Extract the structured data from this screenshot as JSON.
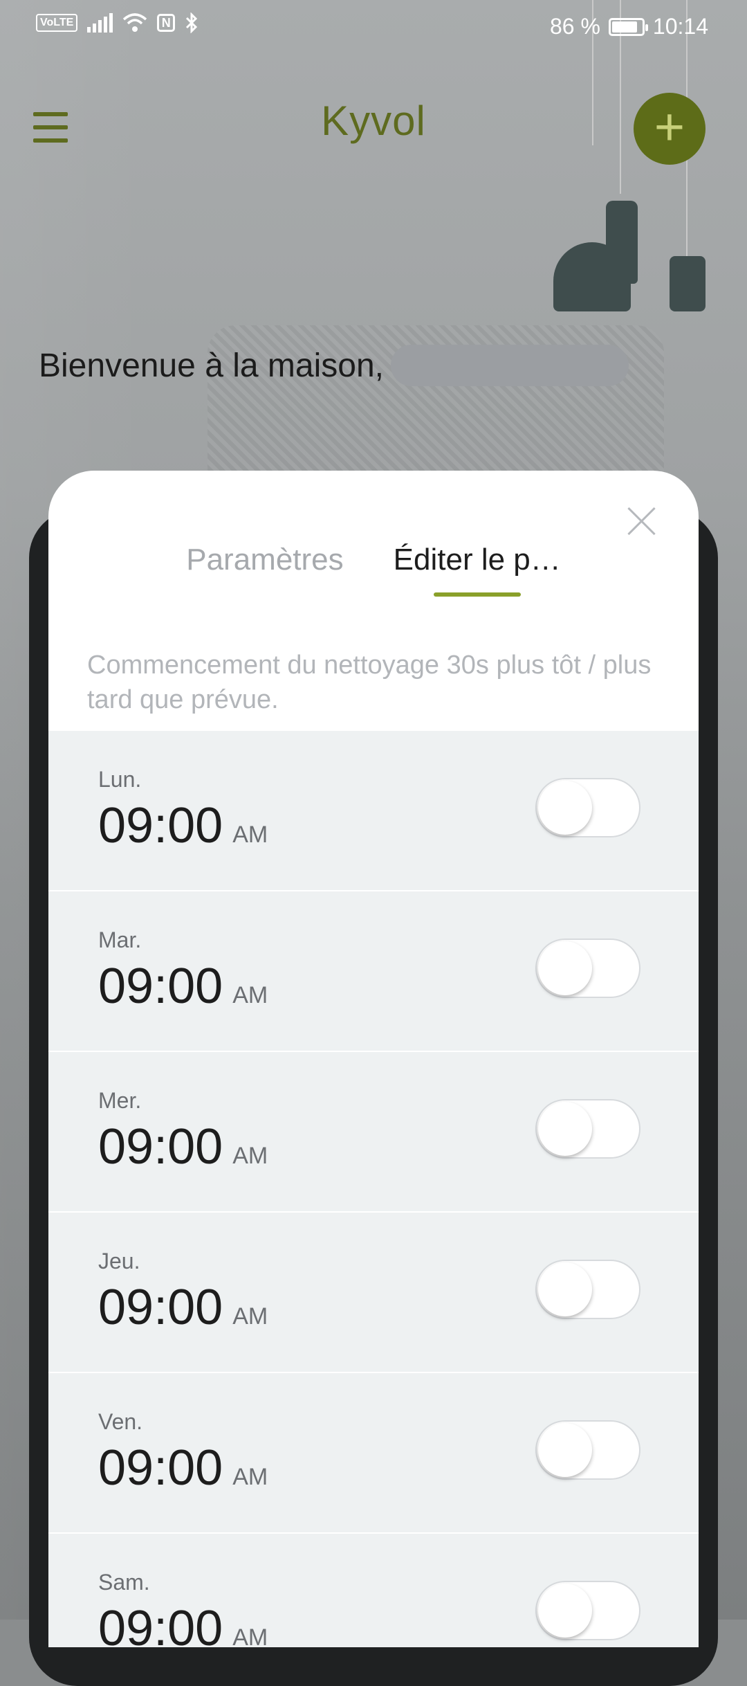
{
  "status_bar": {
    "volte": "VoLTE",
    "nfc": "N",
    "battery_percent": "86 %",
    "battery_level": 0.86,
    "time": "10:14"
  },
  "header": {
    "logo_text": "Kyvol",
    "add_label": "+"
  },
  "welcome": {
    "text": "Bienvenue à la maison,"
  },
  "sheet": {
    "tabs": [
      {
        "label": "Paramètres",
        "active": false
      },
      {
        "label": "Éditer le p…",
        "active": true
      }
    ],
    "hint": "Commencement du nettoyage 30s plus tôt / plus tard que prévue.",
    "schedule": [
      {
        "day": "Lun.",
        "time": "09:00",
        "ampm": "AM",
        "enabled": false
      },
      {
        "day": "Mar.",
        "time": "09:00",
        "ampm": "AM",
        "enabled": false
      },
      {
        "day": "Mer.",
        "time": "09:00",
        "ampm": "AM",
        "enabled": false
      },
      {
        "day": "Jeu.",
        "time": "09:00",
        "ampm": "AM",
        "enabled": false
      },
      {
        "day": "Ven.",
        "time": "09:00",
        "ampm": "AM",
        "enabled": false
      },
      {
        "day": "Sam.",
        "time": "09:00",
        "ampm": "AM",
        "enabled": false
      }
    ]
  },
  "colors": {
    "brand_olive": "#5d6c18",
    "tab_indicator": "#8aa02a",
    "row_background": "#eef1f2"
  }
}
